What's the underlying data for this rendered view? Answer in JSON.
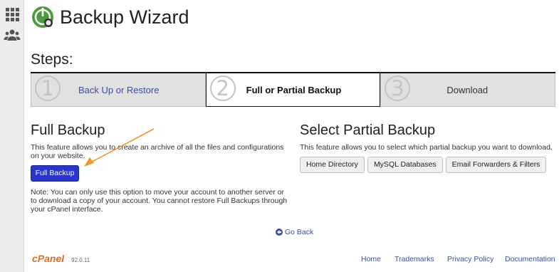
{
  "sidebar": {
    "icons": [
      "grid-icon",
      "users-icon"
    ]
  },
  "header": {
    "title": "Backup Wizard",
    "logo_icon": "backup-wizard-logo-icon"
  },
  "steps": {
    "title": "Steps:",
    "items": [
      {
        "num": "1",
        "label": "Back Up or Restore",
        "state": "done"
      },
      {
        "num": "2",
        "label": "Full or Partial Backup",
        "state": "active"
      },
      {
        "num": "3",
        "label": "Download",
        "state": "pending"
      }
    ]
  },
  "full_backup": {
    "title": "Full Backup",
    "description": "This feature allows you to create an archive of all the files and configurations on your website.",
    "button_label": "Full Backup",
    "note": "Note: You can only use this option to move your account to another server or to download a copy of your account. You cannot restore Full Backups through your cPanel interface."
  },
  "partial_backup": {
    "title": "Select Partial Backup",
    "description": "This feature allows you to select which partial backup you want to download.",
    "buttons": [
      "Home Directory",
      "MySQL Databases",
      "Email Forwarders & Filters"
    ]
  },
  "go_back": {
    "label": "Go Back"
  },
  "footer": {
    "brand": "cPanel",
    "version": "92.0.11",
    "links": [
      "Home",
      "Trademarks",
      "Privacy Policy",
      "Documentation"
    ]
  },
  "colors": {
    "accent": "#2b35c9",
    "link": "#3c4fa0",
    "brand": "#e36c1f",
    "arrow": "#f0962a",
    "logo": "#4b9a3b"
  }
}
